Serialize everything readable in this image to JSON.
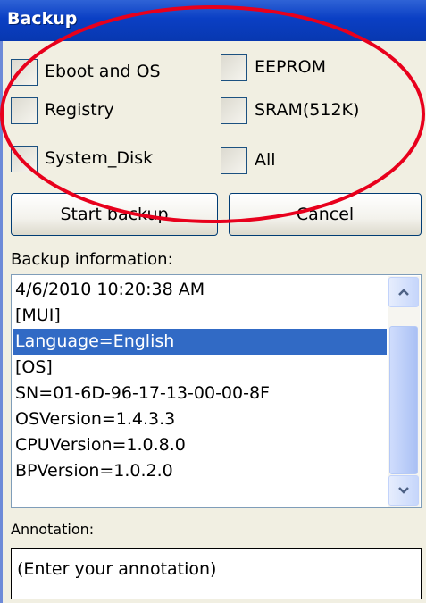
{
  "window": {
    "title": "Backup"
  },
  "options": {
    "eboot_os": "Eboot and OS",
    "eeprom": "EEPROM",
    "registry": "Registry",
    "sram": "SRAM(512K)",
    "system_disk": "System_Disk",
    "all": "All"
  },
  "buttons": {
    "start": "Start backup",
    "cancel": "Cancel"
  },
  "backup_info": {
    "label": "Backup information:",
    "lines": [
      "4/6/2010 10:20:38 AM",
      "[MUI]",
      "Language=English",
      "[OS]",
      "SN=01-6D-96-17-13-00-00-8F",
      "OSVersion=1.4.3.3",
      "CPUVersion=1.0.8.0",
      "BPVersion=1.0.2.0"
    ],
    "selected_index": 2
  },
  "annotation": {
    "label": "Annotation:",
    "placeholder": "(Enter your annotation)"
  },
  "colors": {
    "titlebar": "#0a3fc4",
    "selection": "#316ac5",
    "highlight_ellipse": "#e8001c"
  }
}
